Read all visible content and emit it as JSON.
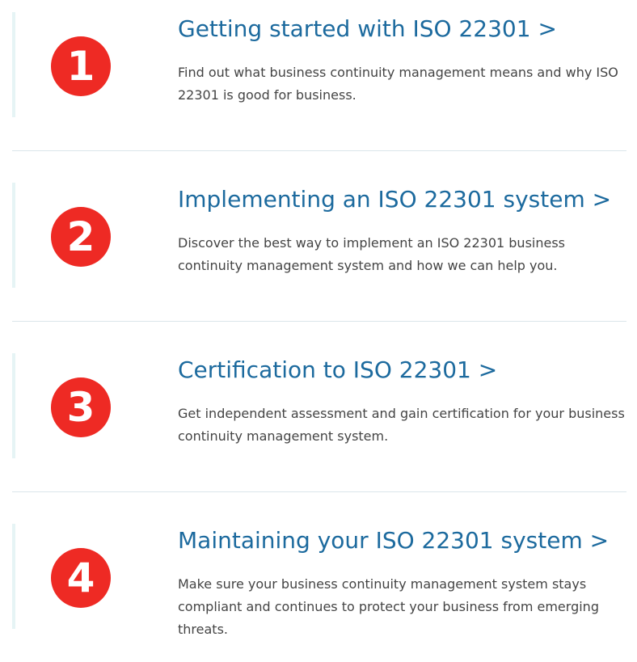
{
  "steps": [
    {
      "number": "1",
      "title": "Getting started with ISO 22301 >",
      "description": "Find out what business continuity management means and why ISO 22301 is good for business."
    },
    {
      "number": "2",
      "title": "Implementing an ISO 22301 system >",
      "description": "Discover the best way to implement an ISO 22301 business continuity management system and how we can help you."
    },
    {
      "number": "3",
      "title": "Certification to ISO 22301 >",
      "description": "Get independent assessment and gain certification for your business continuity management system."
    },
    {
      "number": "4",
      "title": "Maintaining your ISO 22301 system >",
      "description": "Make sure your business continuity management system stays compliant and continues to protect your business from emerging threats."
    }
  ],
  "colors": {
    "badge": "#ee2a24",
    "title": "#1c6a9e",
    "text": "#444444",
    "accent": "#e6f4f5",
    "divider": "#dbe6ea"
  }
}
